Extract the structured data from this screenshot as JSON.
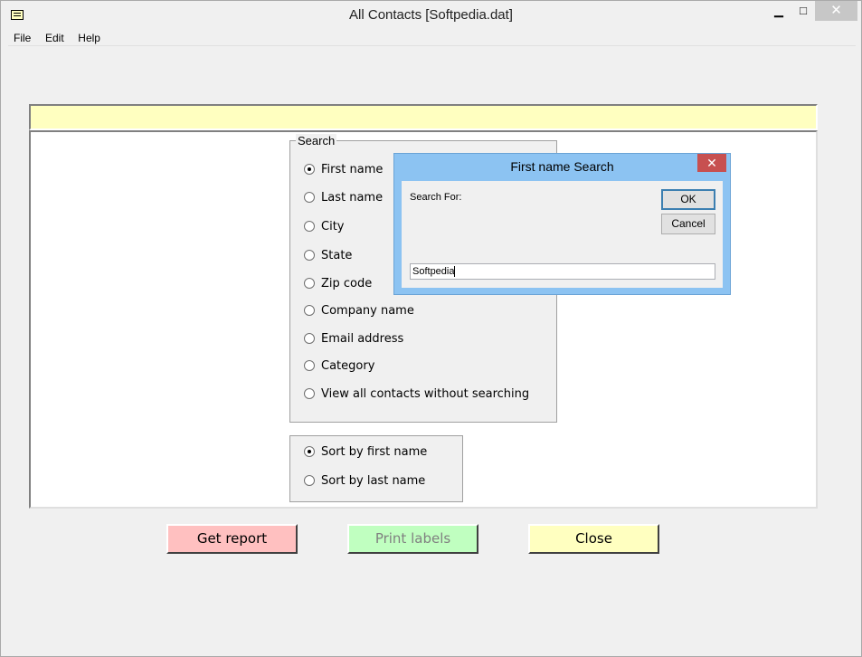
{
  "window": {
    "title": "All Contacts  [Softpedia.dat]",
    "minimize_glyph": "▁",
    "maximize_glyph": "□",
    "close_glyph": "✕"
  },
  "menu": {
    "items": [
      "File",
      "Edit",
      "Help"
    ]
  },
  "search_group": {
    "legend": "Search",
    "options": [
      {
        "label": "First name",
        "checked": true
      },
      {
        "label": "Last name",
        "checked": false
      },
      {
        "label": "City",
        "checked": false
      },
      {
        "label": "State",
        "checked": false
      },
      {
        "label": "Zip code",
        "checked": false
      },
      {
        "label": "Company name",
        "checked": false
      },
      {
        "label": "Email address",
        "checked": false
      },
      {
        "label": "Category",
        "checked": false
      },
      {
        "label": "View all contacts without searching",
        "checked": false
      }
    ]
  },
  "sort_group": {
    "options": [
      {
        "label": "Sort by first name",
        "checked": true
      },
      {
        "label": "Sort by last name",
        "checked": false
      }
    ]
  },
  "buttons": {
    "report": "Get report",
    "print": "Print labels",
    "close": "Close"
  },
  "colors": {
    "report_bg": "#ffc0c0",
    "print_bg": "#c0ffc0",
    "close_bg": "#ffffc0",
    "banner_bg": "#ffffc0",
    "dialog_frame": "#8cc3f2"
  },
  "dialog": {
    "title": "First name Search",
    "close_glyph": "✕",
    "label": "Search For:",
    "ok": "OK",
    "cancel": "Cancel",
    "input_value": "Softpedia"
  }
}
